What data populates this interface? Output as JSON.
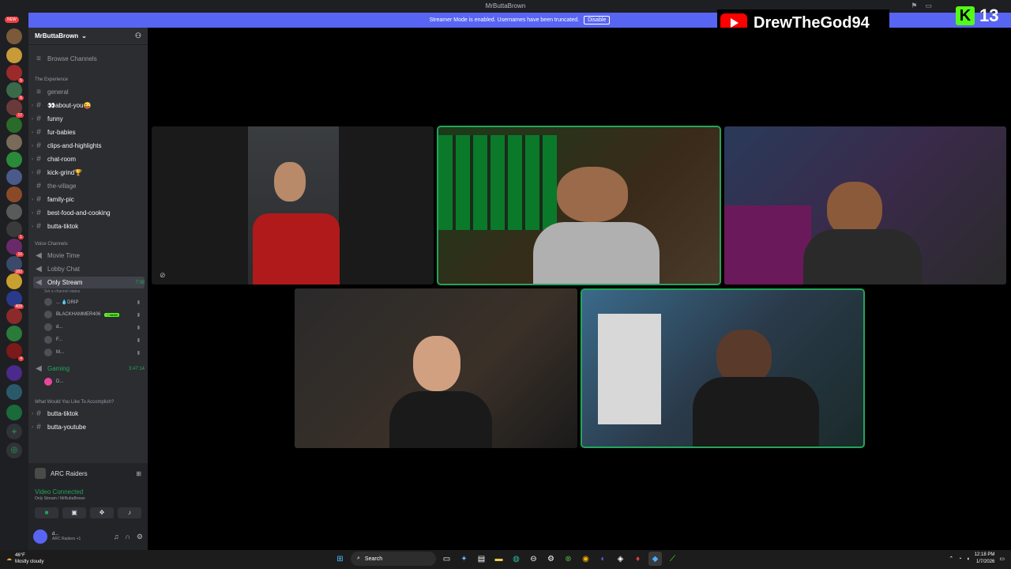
{
  "window": {
    "title": "MrButtaBrown"
  },
  "banner": {
    "text": "Streamer Mode is enabled. Usernames have been truncated.",
    "button": "Disable"
  },
  "overlay": {
    "youtube_name": "DrewTheGod94",
    "kick_count": "13"
  },
  "servers": {
    "new_badge": "NEW",
    "badges": [
      "5",
      "6",
      "17",
      "1",
      "10",
      "182",
      "408",
      "4"
    ]
  },
  "sidebar": {
    "server_name": "MrButtaBrown",
    "browse": "Browse Channels",
    "cat_experience": "The Experience",
    "channels": [
      "general",
      "👀about-you😜",
      "funny",
      "fur-babies",
      "clips-and-highlights",
      "chat-room",
      "kick-grind🏆",
      "the-village",
      "family-pic",
      "best-food-and-cooking",
      "butta-tiktok"
    ],
    "cat_voice": "Voice Channels",
    "voice": [
      "Movie Time",
      "Lobby Chat",
      "Only Stream"
    ],
    "only_stream_timer": "7:38",
    "channel_status": "Set a channel status",
    "voice_users": [
      {
        "name": "... 💧DRIP",
        "tag": ""
      },
      {
        "name": "BLACKHAMMER406",
        "tag": "💚KICK"
      },
      {
        "name": "d...",
        "tag": ""
      },
      {
        "name": "F...",
        "tag": ""
      },
      {
        "name": "M...",
        "tag": ""
      }
    ],
    "gaming": "Gaming",
    "gaming_timer": "3:47:14",
    "gaming_user": "D...",
    "cat_accomplish": "What Would You Like To Accomplish?",
    "bottom_channels": [
      "butta-tiktok",
      "butta-youtube"
    ]
  },
  "activity": {
    "name": "ARC Raiders"
  },
  "voice_connection": {
    "status": "Video Connected",
    "sub": "Only Stream / MrButtaBrown"
  },
  "user": {
    "name": "d...",
    "activity": "ARC Raiders +1"
  },
  "taskbar": {
    "temp": "46°F",
    "weather": "Mostly cloudy",
    "search": "Search",
    "time": "12:18 PM",
    "date": "1/7/2026"
  },
  "colors": {
    "accent": "#5865f2",
    "speaking": "#23a55a",
    "kick": "#53fc18",
    "youtube": "#ff0000"
  }
}
